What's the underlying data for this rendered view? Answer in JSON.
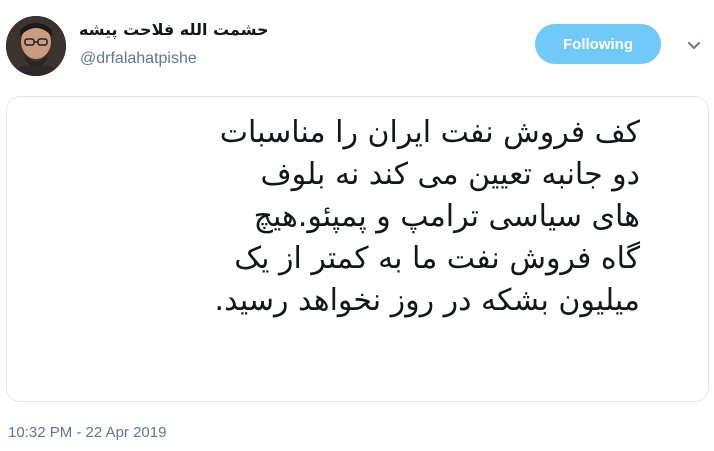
{
  "user": {
    "display_name": "حشمت الله فلاحت پیشه",
    "handle": "@drfalahatpishe"
  },
  "follow_button": {
    "label": "Following"
  },
  "tweet": {
    "lines": [
      "کف فروش نفت ایران را مناسبات",
      "دو جانبه تعیین می کند نه بلوف",
      "های سیاسی ترامپ و پمپئو.هیچ",
      "گاه فروش نفت ما به کمتر از یک",
      "میلیون بشکه در روز نخواهد رسید."
    ]
  },
  "timestamp": "10:32 PM - 22 Apr 2019",
  "icons": {
    "more": "chevron-down-icon",
    "avatar": "avatar"
  },
  "colors": {
    "follow_button_bg": "#71c9f8",
    "secondary_text": "#657786",
    "primary_text": "#14171a",
    "border": "#e1e8ed"
  }
}
